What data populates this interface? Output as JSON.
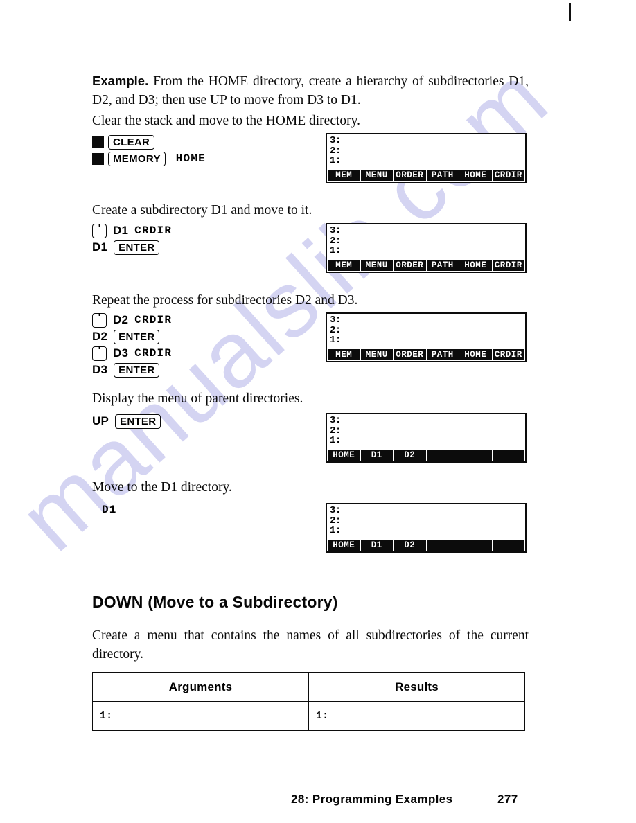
{
  "page": {
    "footer_section": "28: Programming Examples",
    "footer_page_number": "277"
  },
  "watermark": {
    "text": "manualslib.com",
    "color": "#c8c8ef"
  },
  "intro": {
    "lead": "Example.",
    "body": "From the HOME directory, create a hierarchy of subdirectories D1, D2, and D3; then use UP to move from D3 to D1."
  },
  "steps": [
    {
      "instruction": "Clear the stack and move to the HOME directory.",
      "keystrokes": [
        {
          "parts": [
            {
              "type": "shift"
            },
            {
              "type": "boxkey",
              "label": "CLEAR"
            }
          ]
        },
        {
          "parts": [
            {
              "type": "shift"
            },
            {
              "type": "boxkey",
              "label": "MEMORY"
            },
            {
              "type": "gap"
            },
            {
              "type": "menukey",
              "label": "HOME"
            }
          ]
        }
      ],
      "display": {
        "lines": [
          "3:",
          "2:",
          "1:"
        ],
        "menu": [
          "MEM",
          "MENU",
          "ORDER",
          "PATH",
          "HOME",
          "CRDIR"
        ]
      }
    },
    {
      "instruction": "Create a subdirectory D1 and move to it.",
      "keystrokes": [
        {
          "parts": [
            {
              "type": "tickkey",
              "label": "'"
            },
            {
              "type": "plainkey",
              "label": "D1"
            },
            {
              "type": "gap"
            },
            {
              "type": "menukey",
              "label": "CRDIR"
            }
          ]
        },
        {
          "parts": [
            {
              "type": "plainkey",
              "label": "D1"
            },
            {
              "type": "gap"
            },
            {
              "type": "boxkey",
              "label": "ENTER"
            }
          ]
        }
      ],
      "display": {
        "lines": [
          "3:",
          "2:",
          "1:"
        ],
        "menu": [
          "MEM",
          "MENU",
          "ORDER",
          "PATH",
          "HOME",
          "CRDIR"
        ]
      }
    },
    {
      "instruction": "Repeat the process for subdirectories D2 and D3.",
      "keystrokes": [
        {
          "parts": [
            {
              "type": "tickkey",
              "label": "'"
            },
            {
              "type": "plainkey",
              "label": "D2"
            },
            {
              "type": "gap"
            },
            {
              "type": "menukey",
              "label": "CRDIR"
            }
          ]
        },
        {
          "parts": [
            {
              "type": "plainkey",
              "label": "D2"
            },
            {
              "type": "gap"
            },
            {
              "type": "boxkey",
              "label": "ENTER"
            }
          ]
        },
        {
          "parts": [
            {
              "type": "tickkey",
              "label": "'"
            },
            {
              "type": "plainkey",
              "label": "D3"
            },
            {
              "type": "gap"
            },
            {
              "type": "menukey",
              "label": "CRDIR"
            }
          ]
        },
        {
          "parts": [
            {
              "type": "plainkey",
              "label": "D3"
            },
            {
              "type": "gap"
            },
            {
              "type": "boxkey",
              "label": "ENTER"
            }
          ]
        }
      ],
      "display": {
        "lines": [
          "3:",
          "2:",
          "1:"
        ],
        "menu": [
          "MEM",
          "MENU",
          "ORDER",
          "PATH",
          "HOME",
          "CRDIR"
        ]
      }
    },
    {
      "instruction": "Display the menu of parent directories.",
      "keystrokes": [
        {
          "parts": [
            {
              "type": "plainkey",
              "label": "UP"
            },
            {
              "type": "gap"
            },
            {
              "type": "boxkey",
              "label": "ENTER"
            }
          ]
        }
      ],
      "display": {
        "lines": [
          "3:",
          "2:",
          "1:"
        ],
        "menu": [
          "HOME",
          "D1",
          "D2",
          "",
          "",
          ""
        ]
      }
    },
    {
      "instruction": "Move to the D1 directory.",
      "keystrokes": [
        {
          "parts": [
            {
              "type": "menukey",
              "label": "D1"
            }
          ]
        }
      ],
      "display": {
        "lines": [
          "3:",
          "2:",
          "1:"
        ],
        "menu": [
          "HOME",
          "D1",
          "D2",
          "",
          "",
          ""
        ]
      }
    }
  ],
  "down_section": {
    "heading": "DOWN (Move to a Subdirectory)",
    "description": "Create a menu that contains the names of all subdirectories of the current directory.",
    "table": {
      "headers": [
        "Arguments",
        "Results"
      ],
      "rows": [
        [
          "1:",
          "1:"
        ]
      ]
    }
  }
}
